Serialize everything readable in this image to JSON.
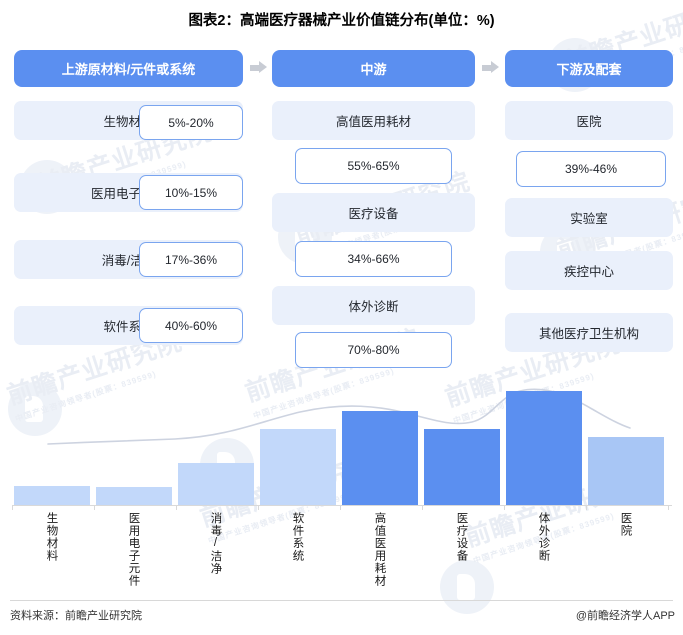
{
  "title": "图表2：高端医疗器械产业价值链分布(单位：%)",
  "flow": {
    "stages": [
      {
        "label": "上游原材料/元件或系统"
      },
      {
        "label": "中游"
      },
      {
        "label": "下游及配套"
      }
    ],
    "arrow_icon_1": "arrow-right-icon",
    "arrow_icon_2": "arrow-right-icon"
  },
  "upstream": {
    "rows": [
      {
        "name": "生物材料",
        "range": "5%-20%"
      },
      {
        "name": "医用电子元件",
        "range": "10%-15%"
      },
      {
        "name": "消毒/洁净",
        "range": "17%-36%"
      },
      {
        "name": "软件系统",
        "range": "40%-60%"
      }
    ]
  },
  "midstream": {
    "rows": [
      {
        "name": "高值医用耗材",
        "range": "55%-65%"
      },
      {
        "name": "医疗设备",
        "range": "34%-66%"
      },
      {
        "name": "体外诊断",
        "range": "70%-80%"
      }
    ]
  },
  "downstream": {
    "rows": [
      {
        "name": "医院",
        "range": "39%-46%"
      },
      {
        "name": "实验室"
      },
      {
        "name": "疾控中心"
      },
      {
        "name": "其他医疗卫生机构"
      }
    ]
  },
  "chart_data": {
    "type": "bar",
    "title": "",
    "xlabel": "",
    "ylabel": "",
    "grid": false,
    "legend": "none",
    "ylim": [
      0,
      100
    ],
    "categories": [
      "生物材料",
      "医用电子元件",
      "消毒/洁净",
      "软件系统",
      "高值医用耗材",
      "医疗设备",
      "体外诊断",
      "医院"
    ],
    "values": [
      15,
      14,
      34,
      62,
      77,
      62,
      94,
      55
    ],
    "colors": [
      "#c2d8fa",
      "#c2d8fa",
      "#c2d8fa",
      "#c2d8fa",
      "#5b8ff0",
      "#5b8ff0",
      "#5b8ff0",
      "#a8c6f5"
    ],
    "overlay_curve": "smooth trend line above bars"
  },
  "footer": {
    "source": "资料来源：前瞻产业研究院",
    "app": "@前瞻经济学人APP"
  },
  "watermark": {
    "big": "前瞻产业研究院",
    "small": "中国产业咨询领导者(股票：839599)"
  },
  "colors": {
    "brand": "#5b8ff0",
    "tint": "#eaf0fb",
    "bar_light": "#c2d8fa",
    "bar_mid": "#a8c6f5",
    "border": "#7aa5ef"
  }
}
